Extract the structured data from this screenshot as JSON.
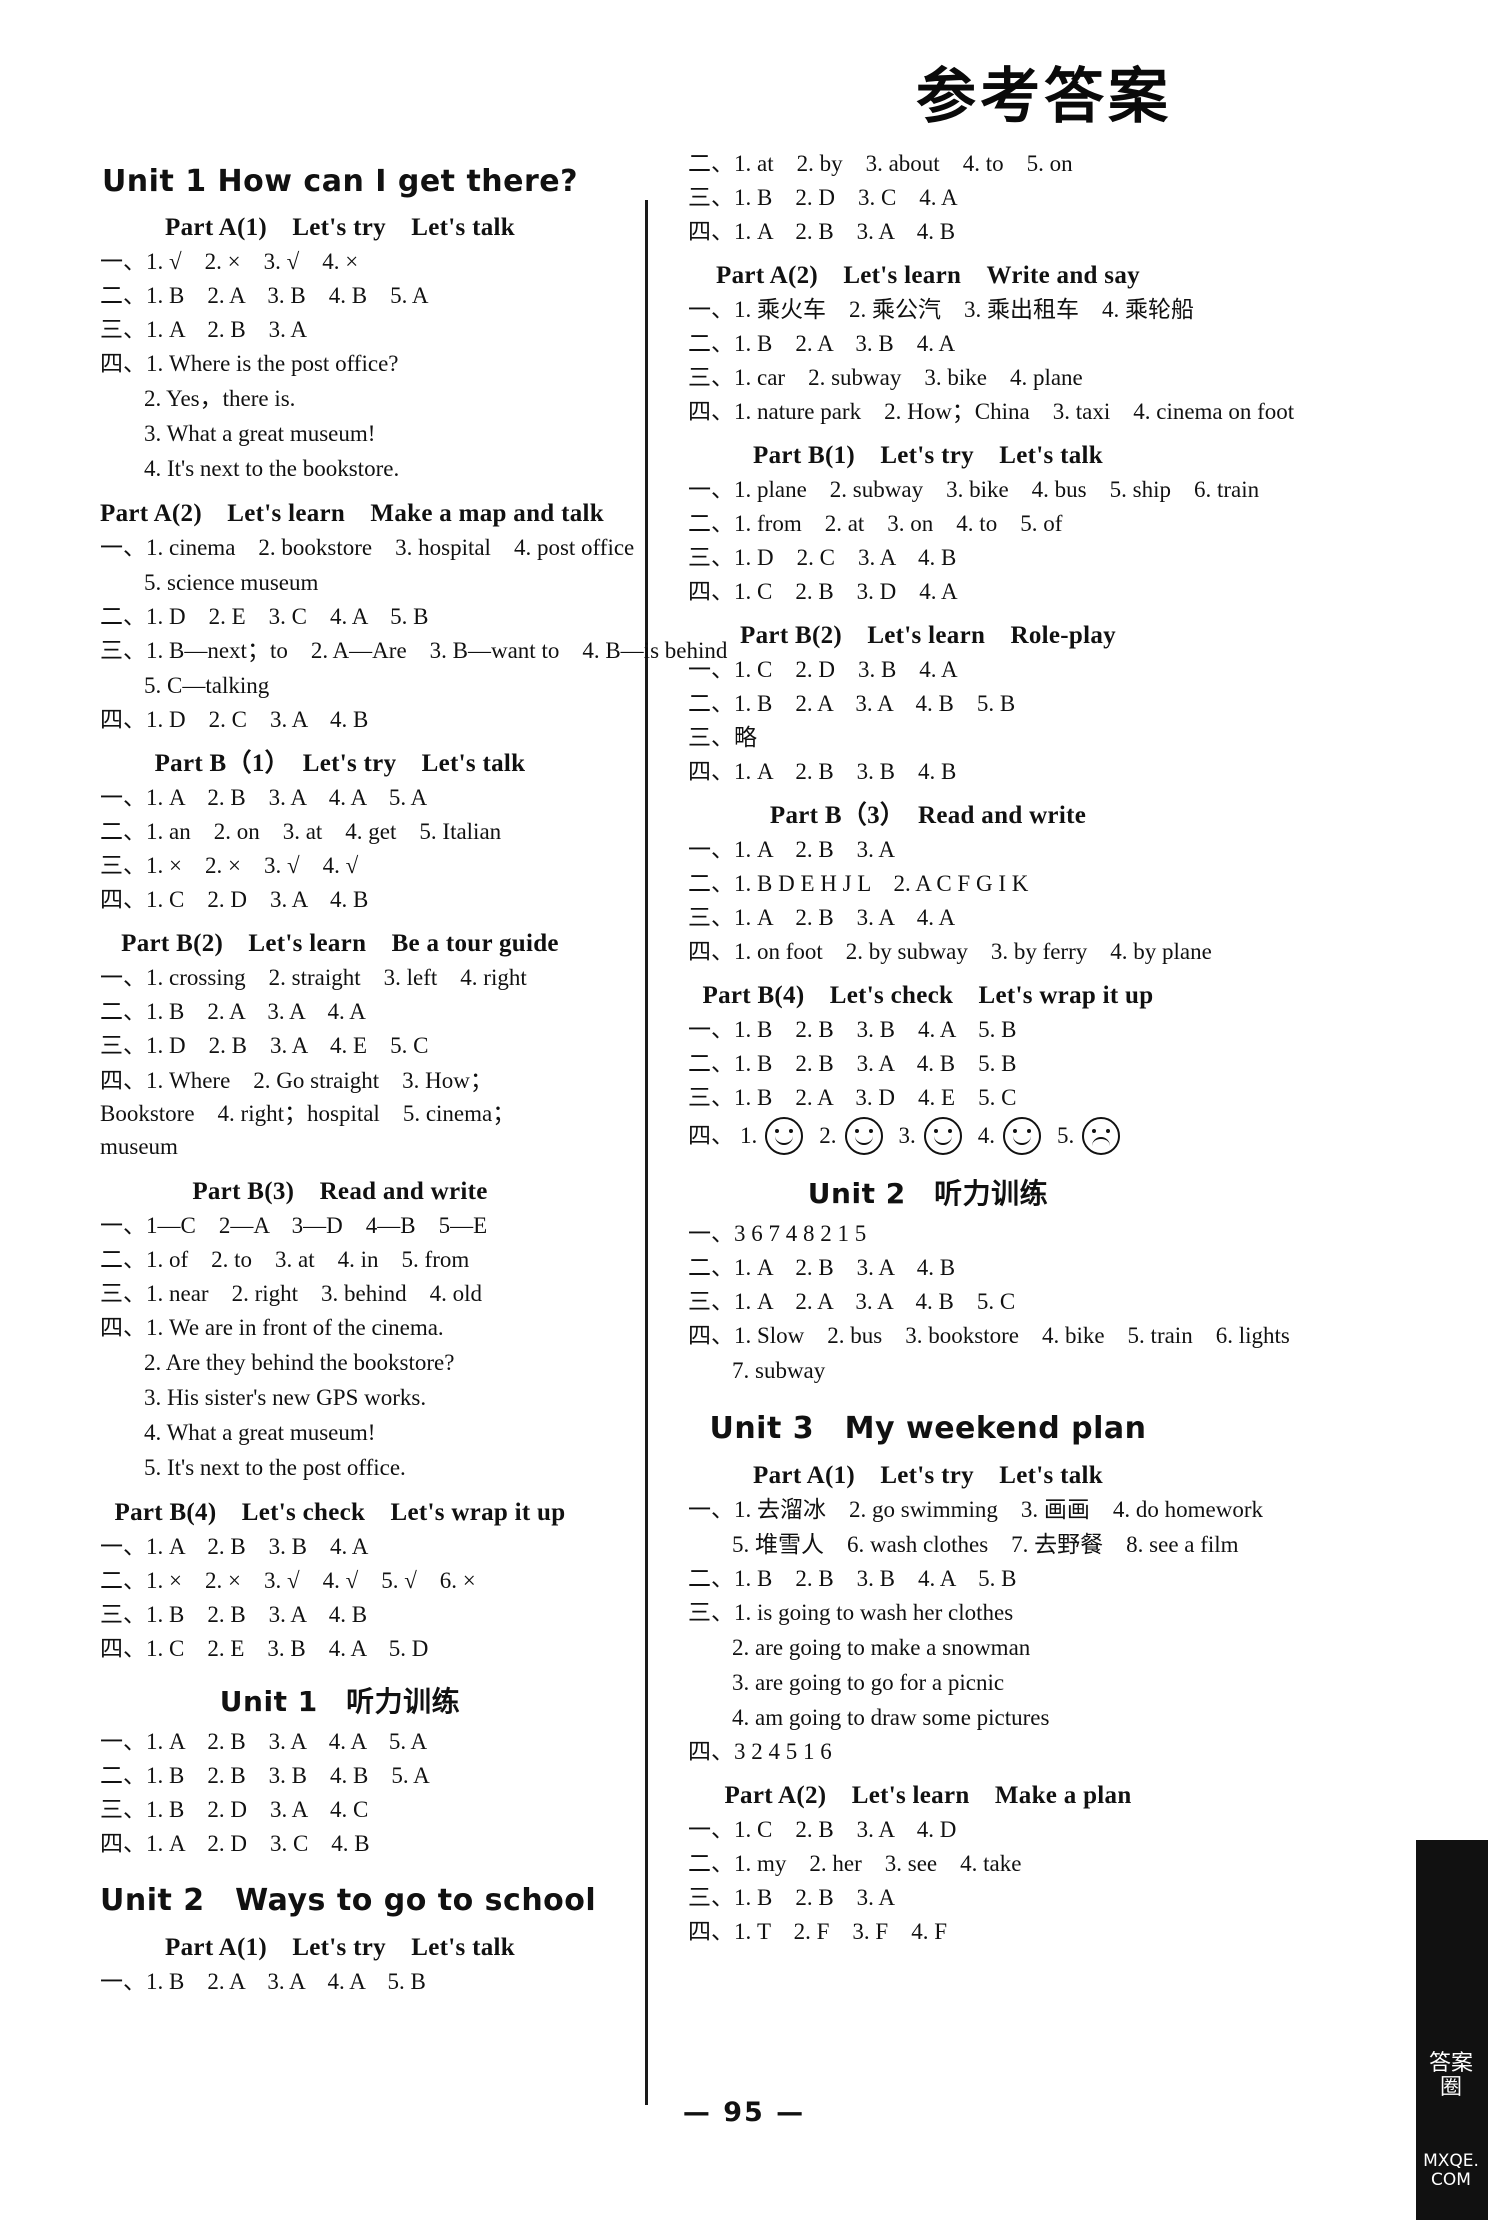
{
  "document": {
    "title": "参考答案",
    "page_number": "— 95 —",
    "watermark_cn": "答案圈",
    "watermark_url": "MXQE.COM"
  },
  "left_column": [
    {
      "type": "unit",
      "text": "Unit 1   How can I get there?"
    },
    {
      "type": "part",
      "text": "Part A(1)　Let's try　Let's talk"
    },
    {
      "type": "ans",
      "text": "一、1. √　2. ×　3. √　4. ×"
    },
    {
      "type": "ans",
      "text": "二、1. B　2. A　3. B　4. B　5. A"
    },
    {
      "type": "ans",
      "text": "三、1. A　2. B　3. A"
    },
    {
      "type": "ans",
      "text": "四、1. Where is the post office?"
    },
    {
      "type": "sub",
      "text": "2. Yes，there is."
    },
    {
      "type": "sub",
      "text": "3. What a great museum!"
    },
    {
      "type": "sub",
      "text": "4. It's next to the bookstore."
    },
    {
      "type": "part",
      "text": "Part A(2)　Let's learn　Make a map and talk"
    },
    {
      "type": "ans",
      "text": "一、1. cinema　2. bookstore　3. hospital　4. post office"
    },
    {
      "type": "sub",
      "text": "5. science museum"
    },
    {
      "type": "ans",
      "text": "二、1. D　2. E　3. C　4. A　5. B"
    },
    {
      "type": "ans",
      "text": "三、1. B—next；to　2. A—Are　3. B—want to　4. B—is behind"
    },
    {
      "type": "sub",
      "text": "5. C—talking"
    },
    {
      "type": "ans",
      "text": "四、1. D　2. C　3. A　4. B"
    },
    {
      "type": "part",
      "text": "Part B（1）　Let's try　Let's talk"
    },
    {
      "type": "ans",
      "text": "一、1. A　2. B　3. A　4. A　5. A"
    },
    {
      "type": "ans",
      "text": "二、1. an　2. on　3. at　4. get　5. Italian"
    },
    {
      "type": "ans",
      "text": "三、1. ×　2. ×　3. √　4. √"
    },
    {
      "type": "ans",
      "text": "四、1. C　2. D　3. A　4. B"
    },
    {
      "type": "part",
      "text": "Part B(2)　Let's learn　Be a tour guide"
    },
    {
      "type": "ans",
      "text": "一、1. crossing　2. straight　3. left　4. right"
    },
    {
      "type": "ans",
      "text": "二、1. B　2. A　3. A　4. A"
    },
    {
      "type": "ans",
      "text": "三、1. D　2. B　3. A　4. E　5. C"
    },
    {
      "type": "ans",
      "wrap": true,
      "text": "四、1. Where　2. Go straight　3. How；Bookstore　4. right；hospital　5. cinema；museum"
    },
    {
      "type": "part",
      "text": "Part B(3)　Read and write"
    },
    {
      "type": "ans",
      "text": "一、1—C　2—A　3—D　4—B　5—E"
    },
    {
      "type": "ans",
      "text": "二、1. of　2. to　3. at　4. in　5. from"
    },
    {
      "type": "ans",
      "text": "三、1. near　2. right　3. behind　4. old"
    },
    {
      "type": "ans",
      "text": "四、1. We are in front of the cinema."
    },
    {
      "type": "sub",
      "text": "2. Are they behind the bookstore?"
    },
    {
      "type": "sub",
      "text": "3. His sister's new GPS works."
    },
    {
      "type": "sub",
      "text": "4. What a great museum!"
    },
    {
      "type": "sub",
      "text": "5. It's next to the post office."
    },
    {
      "type": "part",
      "text": "Part B(4)　Let's check　Let's wrap it up"
    },
    {
      "type": "ans",
      "text": "一、1. A　2. B　3. B　4. A"
    },
    {
      "type": "ans",
      "text": "二、1. ×　2. ×　3. √　4. √　5. √　6. ×"
    },
    {
      "type": "ans",
      "text": "三、1. B　2. B　3. A　4. B"
    },
    {
      "type": "ans",
      "text": "四、1. C　2. E　3. B　4. A　5. D"
    },
    {
      "type": "unit-cn",
      "text": "Unit 1　听力训练"
    },
    {
      "type": "ans",
      "text": "一、1. A　2. B　3. A　4. A　5. A"
    },
    {
      "type": "ans",
      "text": "二、1. B　2. B　3. B　4. B　5. A"
    },
    {
      "type": "ans",
      "text": "三、1. B　2. D　3. A　4. C"
    },
    {
      "type": "ans",
      "text": "四、1. A　2. D　3. C　4. B"
    },
    {
      "type": "unit",
      "text": "Unit 2　Ways to go to school"
    },
    {
      "type": "part",
      "text": "Part A(1)　Let's try　Let's talk"
    },
    {
      "type": "ans",
      "text": "一、1. B　2. A　3. A　4. A　5. B"
    }
  ],
  "right_column": [
    {
      "type": "ans",
      "text": "二、1. at　2. by　3. about　4. to　5. on"
    },
    {
      "type": "ans",
      "text": "三、1. B　2. D　3. C　4. A"
    },
    {
      "type": "ans",
      "text": "四、1. A　2. B　3. A　4. B"
    },
    {
      "type": "part",
      "text": "Part A(2)　Let's learn　Write and say"
    },
    {
      "type": "ans",
      "text": "一、1. 乘火车　2. 乘公汽　3. 乘出租车　4. 乘轮船"
    },
    {
      "type": "ans",
      "text": "二、1. B　2. A　3. B　4. A"
    },
    {
      "type": "ans",
      "text": "三、1. car　2. subway　3. bike　4. plane"
    },
    {
      "type": "ans",
      "text": "四、1. nature park　2. How；China　3. taxi　4. cinema on foot"
    },
    {
      "type": "part",
      "text": "Part B(1)　Let's try　Let's talk"
    },
    {
      "type": "ans",
      "text": "一、1. plane　2. subway　3. bike　4. bus　5. ship　6. train"
    },
    {
      "type": "ans",
      "text": "二、1. from　2. at　3. on　4. to　5. of"
    },
    {
      "type": "ans",
      "text": "三、1. D　2. C　3. A　4. B"
    },
    {
      "type": "ans",
      "text": "四、1. C　2. B　3. D　4. A"
    },
    {
      "type": "part",
      "text": "Part B(2)　Let's learn　Role-play"
    },
    {
      "type": "ans",
      "text": "一、1. C　2. D　3. B　4. A"
    },
    {
      "type": "ans",
      "text": "二、1. B　2. A　3. A　4. B　5. B"
    },
    {
      "type": "ans",
      "text": "三、略"
    },
    {
      "type": "ans",
      "text": "四、1. A　2. B　3. B　4. B"
    },
    {
      "type": "part",
      "text": "Part B（3）　Read and write"
    },
    {
      "type": "ans",
      "text": "一、1. A　2. B　3. A"
    },
    {
      "type": "ans",
      "text": "二、1. B D E H J L　2. A C F G I K"
    },
    {
      "type": "ans",
      "text": "三、1. A　2. B　3. A　4. A"
    },
    {
      "type": "ans",
      "text": "四、1. on foot　2. by subway　3. by ferry　4. by plane"
    },
    {
      "type": "part",
      "text": "Part B(4)　Let's check　Let's wrap it up"
    },
    {
      "type": "ans",
      "text": "一、1. B　2. B　3. B　4. A　5. B"
    },
    {
      "type": "ans",
      "text": "二、1. B　2. B　3. A　4. B　5. B"
    },
    {
      "type": "ans",
      "text": "三、1. B　2. A　3. D　4. E　5. C"
    },
    {
      "type": "emoji",
      "prefix": "四、1.",
      "items": [
        {
          "n": "1.",
          "mood": "happy"
        },
        {
          "n": "2.",
          "mood": "happy"
        },
        {
          "n": "3.",
          "mood": "happy"
        },
        {
          "n": "4.",
          "mood": "happy"
        },
        {
          "n": "5.",
          "mood": "sad"
        }
      ]
    },
    {
      "type": "unit-cn",
      "text": "Unit 2　听力训练"
    },
    {
      "type": "ans",
      "text": "一、3  6  7  4  8  2  1  5"
    },
    {
      "type": "ans",
      "text": "二、1. A　2. B　3. A　4. B"
    },
    {
      "type": "ans",
      "text": "三、1. A　2. A　3. A　4. B　5. C"
    },
    {
      "type": "ans",
      "text": "四、1. Slow　2. bus　3. bookstore　4. bike　5. train　6. lights"
    },
    {
      "type": "sub",
      "text": "7. subway"
    },
    {
      "type": "unit",
      "text": "Unit 3　My weekend plan"
    },
    {
      "type": "part",
      "text": "Part A(1)　Let's try　Let's talk"
    },
    {
      "type": "ans",
      "text": "一、1. 去溜冰　2. go swimming　3. 画画　4. do homework"
    },
    {
      "type": "sub",
      "text": "5. 堆雪人　6. wash clothes　7. 去野餐　8. see a film"
    },
    {
      "type": "ans",
      "text": "二、1. B　2. B　3. B　4. A　5. B"
    },
    {
      "type": "ans",
      "text": "三、1. is going to wash her clothes"
    },
    {
      "type": "sub",
      "text": "2. are going to make a snowman"
    },
    {
      "type": "sub",
      "text": "3. are going to go for a picnic"
    },
    {
      "type": "sub",
      "text": "4. am going to draw some pictures"
    },
    {
      "type": "ans",
      "text": "四、3  2  4  5  1  6"
    },
    {
      "type": "part",
      "text": "Part A(2)　Let's learn　Make a plan"
    },
    {
      "type": "ans",
      "text": "一、1. C　2. B　3. A　4. D"
    },
    {
      "type": "ans",
      "text": "二、1. my　2. her　3. see　4. take"
    },
    {
      "type": "ans",
      "text": "三、1. B　2. B　3. A"
    },
    {
      "type": "ans",
      "text": "四、1. T　2. F　3. F　4. F"
    }
  ]
}
